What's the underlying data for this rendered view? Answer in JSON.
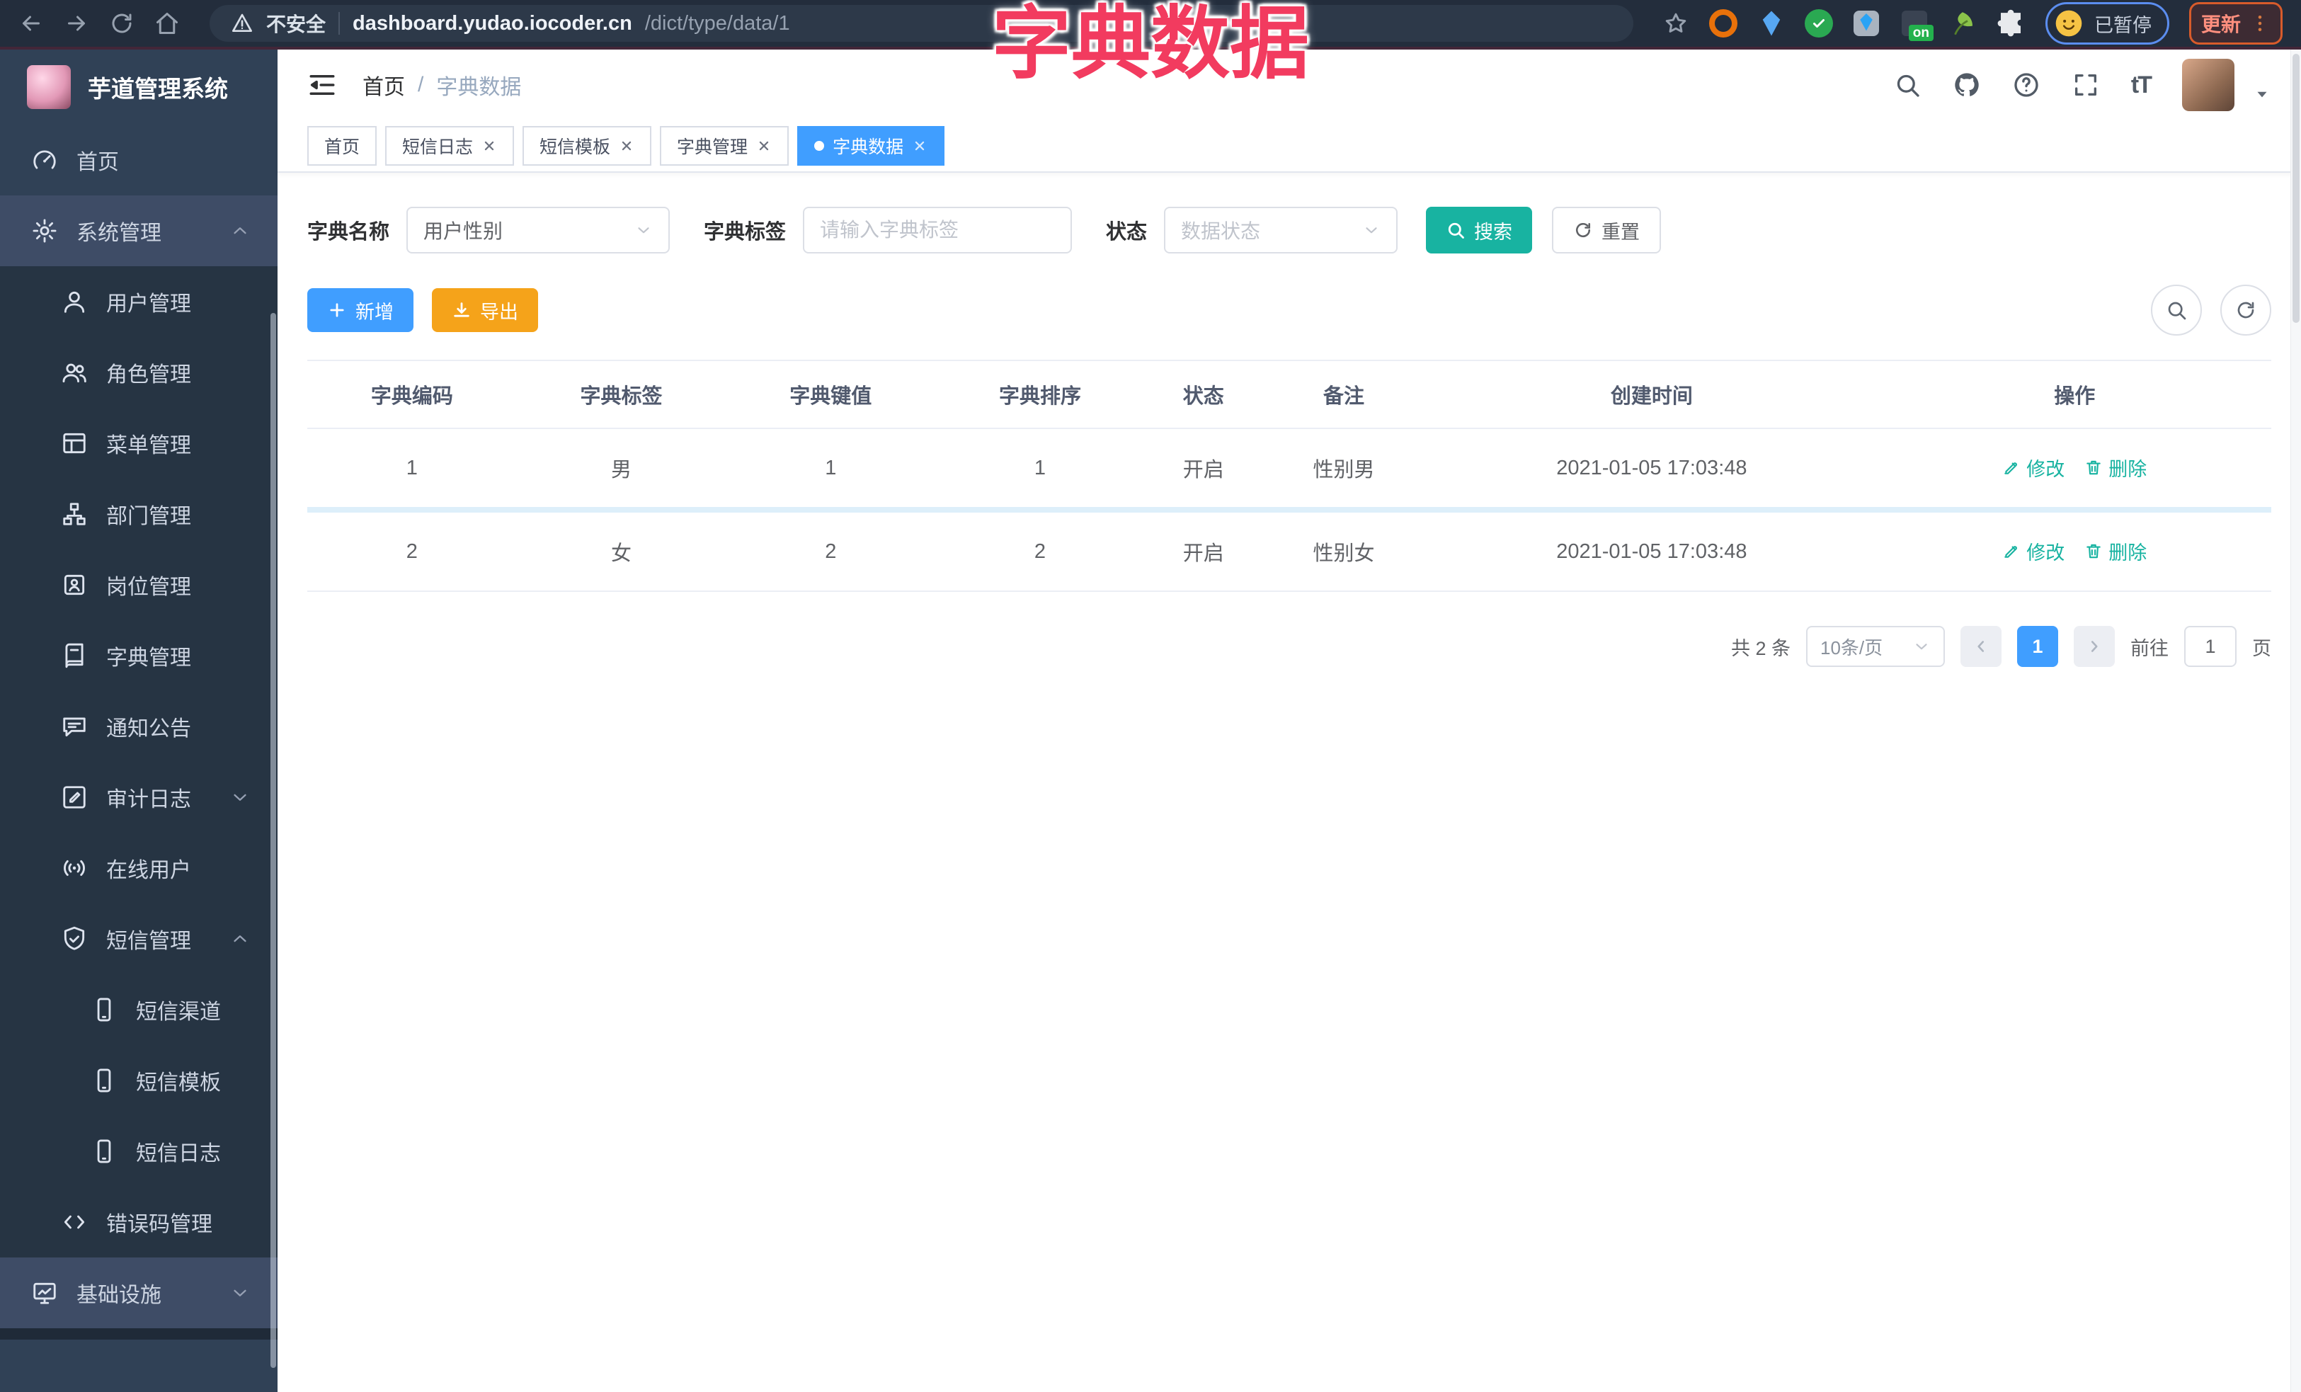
{
  "colors": {
    "primary": "#409eff",
    "teal": "#18b3a1",
    "orange": "#f5a31a",
    "annotation": "#f23b5f"
  },
  "overlay_title": "字典数据",
  "browser": {
    "security_label": "不安全",
    "url_host": "dashboard.yudao.iocoder.cn",
    "url_path": "/dict/type/data/1",
    "extension_badge": "on",
    "profile_status": "已暂停",
    "update_label": "更新"
  },
  "sidebar": {
    "app_title": "芋道管理系统",
    "items": [
      {
        "label": "首页",
        "icon": "dashboard-icon",
        "level": 0,
        "variant": ""
      },
      {
        "label": "系统管理",
        "icon": "gear-icon",
        "level": 0,
        "variant": "open-title",
        "chevron": "up"
      },
      {
        "label": "用户管理",
        "icon": "user-icon",
        "level": 1,
        "variant": "child"
      },
      {
        "label": "角色管理",
        "icon": "users-icon",
        "level": 1,
        "variant": "child"
      },
      {
        "label": "菜单管理",
        "icon": "menu-list-icon",
        "level": 1,
        "variant": "child"
      },
      {
        "label": "部门管理",
        "icon": "org-tree-icon",
        "level": 1,
        "variant": "child"
      },
      {
        "label": "岗位管理",
        "icon": "id-badge-icon",
        "level": 1,
        "variant": "child"
      },
      {
        "label": "字典管理",
        "icon": "dictionary-icon",
        "level": 1,
        "variant": "child"
      },
      {
        "label": "通知公告",
        "icon": "announcement-icon",
        "level": 1,
        "variant": "child"
      },
      {
        "label": "审计日志",
        "icon": "audit-log-icon",
        "level": 1,
        "variant": "child",
        "chevron": "down"
      },
      {
        "label": "在线用户",
        "icon": "online-users-icon",
        "level": 1,
        "variant": "child"
      },
      {
        "label": "短信管理",
        "icon": "sms-shield-icon",
        "level": 1,
        "variant": "child",
        "chevron": "up"
      },
      {
        "label": "短信渠道",
        "icon": "mobile-icon",
        "level": 2,
        "variant": "child"
      },
      {
        "label": "短信模板",
        "icon": "mobile-icon",
        "level": 2,
        "variant": "child"
      },
      {
        "label": "短信日志",
        "icon": "mobile-icon",
        "level": 2,
        "variant": "child"
      },
      {
        "label": "错误码管理",
        "icon": "code-icon",
        "level": 1,
        "variant": "child"
      },
      {
        "label": "基础设施",
        "icon": "monitor-icon",
        "level": 0,
        "variant": "open-title",
        "chevron": "down"
      }
    ]
  },
  "header": {
    "breadcrumb_home": "首页",
    "breadcrumb_separator": "/",
    "breadcrumb_current": "字典数据",
    "font_size_glyph": "tT"
  },
  "tabs": [
    {
      "label": "首页",
      "active": false,
      "closable": false
    },
    {
      "label": "短信日志",
      "active": false,
      "closable": true
    },
    {
      "label": "短信模板",
      "active": false,
      "closable": true
    },
    {
      "label": "字典管理",
      "active": false,
      "closable": true
    },
    {
      "label": "字典数据",
      "active": true,
      "closable": true
    }
  ],
  "filters": {
    "name_label": "字典名称",
    "name_value": "用户性别",
    "tag_label": "字典标签",
    "tag_placeholder": "请输入字典标签",
    "status_label": "状态",
    "status_placeholder": "数据状态",
    "search_label": "搜索",
    "reset_label": "重置"
  },
  "toolbar": {
    "add_label": "新增",
    "export_label": "导出"
  },
  "table": {
    "headers": [
      "字典编码",
      "字典标签",
      "字典键值",
      "字典排序",
      "状态",
      "备注",
      "创建时间",
      "操作"
    ],
    "rows": [
      {
        "code": "1",
        "tag": "男",
        "value": "1",
        "sort": "1",
        "status": "开启",
        "remark": "性别男",
        "created": "2021-01-05 17:03:48"
      },
      {
        "code": "2",
        "tag": "女",
        "value": "2",
        "sort": "2",
        "status": "开启",
        "remark": "性别女",
        "created": "2021-01-05 17:03:48"
      }
    ],
    "actions": {
      "edit": "修改",
      "delete": "删除"
    }
  },
  "pagination": {
    "total_label": "共 2 条",
    "page_size_label": "10条/页",
    "current_page": "1",
    "goto_prefix": "前往",
    "goto_value": "1",
    "goto_suffix": "页"
  }
}
